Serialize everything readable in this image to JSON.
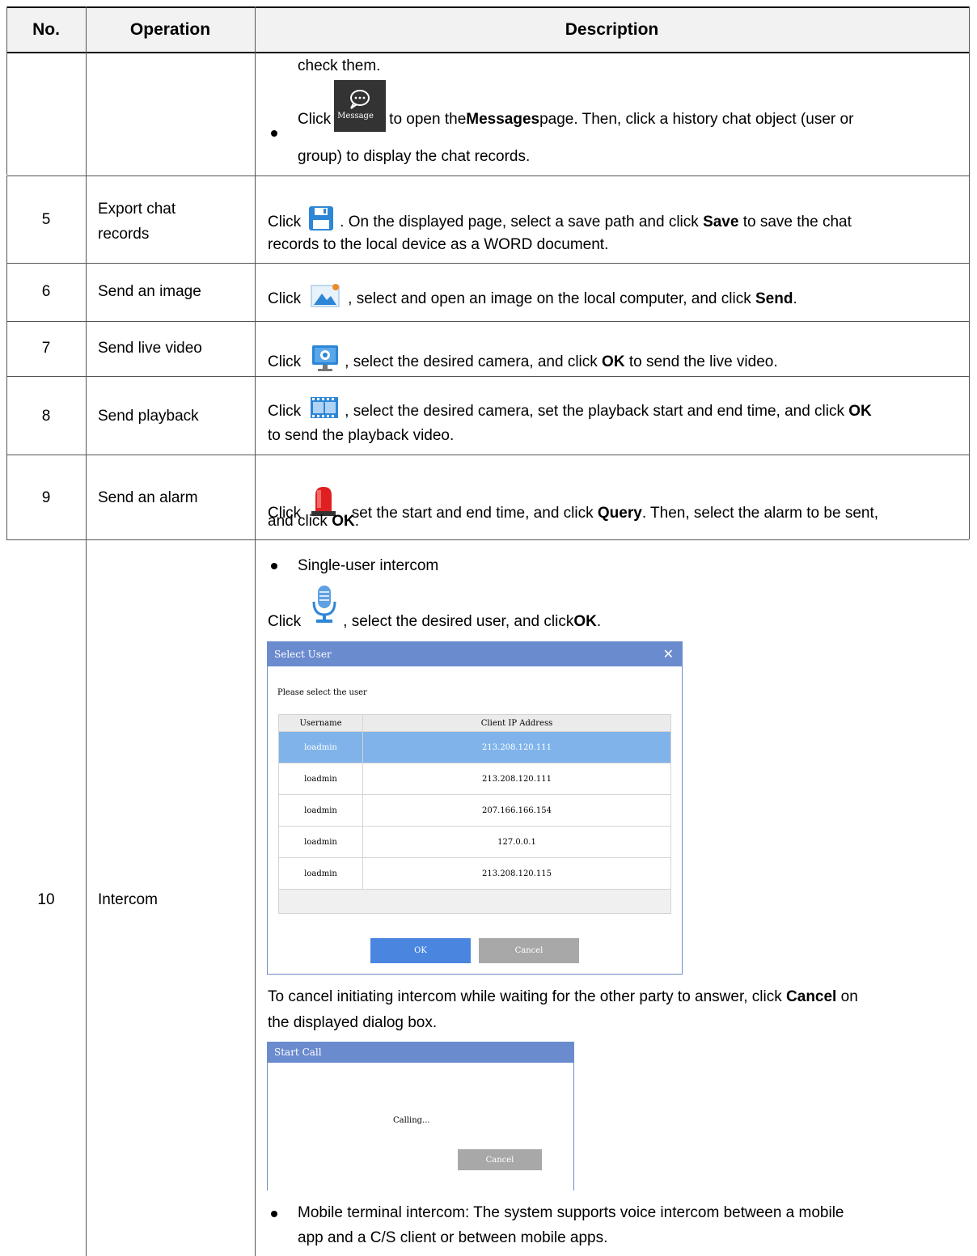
{
  "header": {
    "no": "No.",
    "operation": "Operation",
    "description": "Description"
  },
  "row4": {
    "line1": "check them.",
    "click": "Click",
    "icon_label": "Message",
    "t1": " to open the ",
    "b1": "Messages",
    "t2": " page. Then, click a history chat object (user or",
    "line3": "group) to display the chat records."
  },
  "rows": [
    {
      "no": "5",
      "op1": "Export chat",
      "op2": "records",
      "click": "Click",
      "t1": ". On the displayed page, select a save path and click ",
      "b1": "Save",
      "t2": " to save the chat",
      "line2": "records to the local device as a WORD document."
    },
    {
      "no": "6",
      "op": "Send an image",
      "click": "Click",
      "t1": ", select and open an image on the local computer, and click ",
      "b1": "Send",
      "t2": "."
    },
    {
      "no": "7",
      "op": "Send live video",
      "click": "Click",
      "t1": ", select the desired camera, and click ",
      "b1": "OK",
      "t2": " to send the live video."
    },
    {
      "no": "8",
      "op": "Send playback",
      "click": "Click",
      "t1": ", select the desired camera, set the playback start and end time, and click ",
      "b1": "OK",
      "line2": "to send the playback video."
    },
    {
      "no": "9",
      "op": "Send an alarm",
      "click": "Click",
      "t1": ", set the start and end time, and click ",
      "b1": "Query",
      "t2": ". Then, select the alarm to be sent,",
      "line2a": "and click ",
      "line2b": "OK",
      "line2c": "."
    }
  ],
  "row10": {
    "no": "10",
    "op": "Intercom",
    "bullet1": "Single-user intercom",
    "click": "Click",
    "t1": ", select the desired user, and click ",
    "b1": "OK",
    "t2": ".",
    "para1": "To cancel initiating intercom while waiting for the other party to answer, click ",
    "para1b": "Cancel",
    "para1c": " on",
    "para2": "the displayed dialog box.",
    "bullet2a": "Mobile terminal intercom: The system supports voice intercom between a mobile",
    "bullet2b": "app and a C/S client or between mobile apps."
  },
  "select_user": {
    "title": "Select User",
    "prompt": "Please select the  user",
    "col1": "Username",
    "col2": "Client IP Address",
    "rows": [
      {
        "user": "loadmin",
        "ip": "213.208.120.111"
      },
      {
        "user": "loadmin",
        "ip": "213.208.120.111"
      },
      {
        "user": "loadmin",
        "ip": "207.166.166.154"
      },
      {
        "user": "loadmin",
        "ip": "127.0.0.1"
      },
      {
        "user": "loadmin",
        "ip": "213.208.120.115"
      }
    ],
    "ok": "OK",
    "cancel": "Cancel"
  },
  "start_call": {
    "title": "Start Call",
    "status": "Calling...",
    "cancel": "Cancel"
  },
  "colors": {
    "dialog_title": "#6b8bcf",
    "selected_row": "#7fb3ea",
    "ok_button": "#4a86e0",
    "cancel_button": "#a8a8a8",
    "header_bg": "#f2f2f2"
  }
}
